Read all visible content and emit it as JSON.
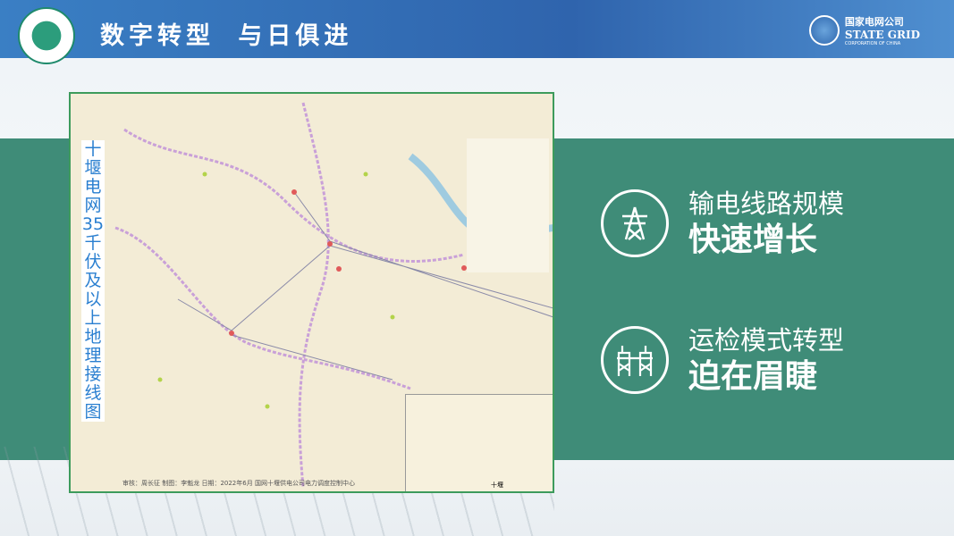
{
  "header": {
    "title": "数字转型  与日俱进",
    "logo_text": "国家电网公司 STATE GRID CORPORATION OF CHINA",
    "brand": {
      "cn": "国家电网公司",
      "en": "STATE GRID",
      "sub": "CORPORATION OF CHINA"
    }
  },
  "map": {
    "title": "十堰电网35千伏及以上地理接线图",
    "footer": "审核：周长征  制图：李魁龙  日期：2022年6月    国网十堰供电公司电力调度控制中心",
    "inset_label": "十堰"
  },
  "items": [
    {
      "line1": "输电线路规模",
      "line2": "快速增长",
      "icon": "transmission-tower-icon"
    },
    {
      "line1": "运检模式转型",
      "line2": "迫在眉睫",
      "icon": "substation-icon"
    }
  ],
  "colors": {
    "header": "#2f64ad",
    "band": "#3f8c78",
    "map_border": "#3d9b5c"
  }
}
